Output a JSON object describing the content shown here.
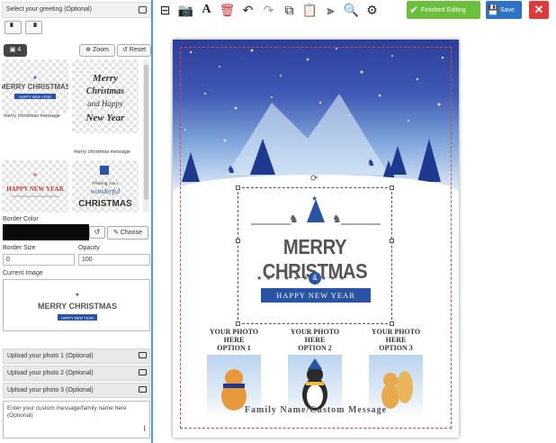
{
  "left_panel": {
    "greeting_header": "Select your greeting (Optional)",
    "image_count": "4",
    "zoom_label": "Zoom",
    "reset_label": "Reset",
    "thumbnails": [
      {
        "title": "merry christmas message",
        "heading": "MERRY CHRISTMAS",
        "sub": "HAPPY NEW YEAR"
      },
      {
        "title": "merry christmas message",
        "heading": "Merry Christmas",
        "sub": "and Happy New Year"
      },
      {
        "title": "",
        "heading": "HAPPY NEW YEAR",
        "sub": ""
      },
      {
        "title": "",
        "heading": "wonderful CHRISTMAS",
        "sub": "Wishing you a"
      }
    ],
    "border_color_label": "Border Color",
    "border_color_value": "#0a0a0a",
    "choose_label": "Choose",
    "border_size_label": "Border Size",
    "border_size_value": "0",
    "opacity_label": "Opacity",
    "opacity_value": "100",
    "current_image_label": "Current Image",
    "uploads": [
      "Upload your photo 1 (Optional)",
      "Upload your photo 2 (Optional)",
      "Upload your photo 3 (Optional)"
    ],
    "custom_message_placeholder": "Enter your custom message/family name here (Optional)"
  },
  "toolbar": {
    "finished_label": "Finished Editing",
    "save_label": "Save",
    "finished_color": "#6bbf3a",
    "save_color": "#2c72c6",
    "close_color": "#e03939"
  },
  "card": {
    "merry": "MERRY CHRISTMAS",
    "amp": "&",
    "happy_new_year": "HAPPY NEW YEAR",
    "stars": "★ ★ ★ ★ ★      ★ ★ ★ ★ ★",
    "photos": [
      {
        "line1": "YOUR PHOTO",
        "line2": "HERE",
        "line3": "OPTION 1"
      },
      {
        "line1": "YOUR PHOTO",
        "line2": "HERE",
        "line3": "OPTION 2"
      },
      {
        "line1": "YOUR PHOTO",
        "line2": "HERE",
        "line3": "OPTION 3"
      }
    ],
    "family_name": "Family Name/Custom Message"
  }
}
